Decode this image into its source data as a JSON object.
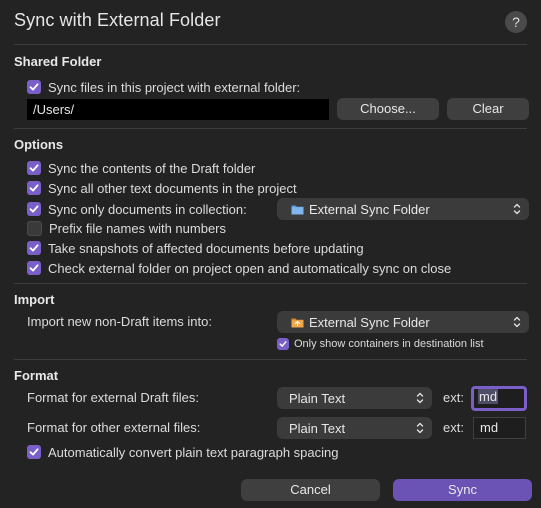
{
  "dialog": {
    "title": "Sync with External Folder",
    "help_label": "?"
  },
  "shared_folder": {
    "heading": "Shared Folder",
    "sync_checkbox_label": "Sync files in this project with external folder:",
    "path_value": "/Users/",
    "choose_label": "Choose...",
    "clear_label": "Clear"
  },
  "options": {
    "heading": "Options",
    "items": [
      {
        "label": "Sync the contents of the Draft folder",
        "checked": true
      },
      {
        "label": "Sync all other text documents in the project",
        "checked": true
      },
      {
        "label": "Sync only documents in collection:",
        "checked": true
      },
      {
        "label": "Prefix file names with numbers",
        "checked": false
      },
      {
        "label": "Take snapshots of affected documents before updating",
        "checked": true
      },
      {
        "label": "Check external folder on project open and automatically sync on close",
        "checked": true
      }
    ],
    "collection_value": "External Sync Folder"
  },
  "import": {
    "heading": "Import",
    "label": "Import new non-Draft items into:",
    "destination_value": "External Sync Folder",
    "only_containers_label": "Only show containers in destination list"
  },
  "format": {
    "heading": "Format",
    "draft_label": "Format for external Draft files:",
    "draft_format": "Plain Text",
    "draft_ext_label": "ext:",
    "draft_ext_value": "md",
    "other_label": "Format for other external files:",
    "other_format": "Plain Text",
    "other_ext_label": "ext:",
    "other_ext_value": "md",
    "auto_convert_label": "Automatically convert plain text paragraph spacing"
  },
  "footer": {
    "cancel_label": "Cancel",
    "sync_label": "Sync"
  },
  "colors": {
    "accent": "#7a5fc8",
    "background": "#232323",
    "primary_button": "#6b52b5"
  }
}
